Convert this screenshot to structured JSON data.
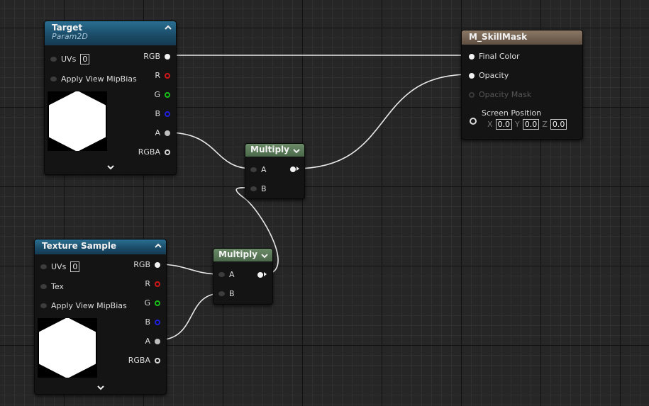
{
  "nodes": {
    "target": {
      "title": "Target",
      "subtitle": "Param2D",
      "uvs_label": "UVs",
      "uvs_value": "0",
      "mip_label": "Apply View MipBias",
      "outputs": [
        "RGB",
        "R",
        "G",
        "B",
        "A",
        "RGBA"
      ]
    },
    "multiply_top": {
      "title": "Multiply",
      "inputs": [
        "A",
        "B"
      ]
    },
    "multiply_bottom": {
      "title": "Multiply",
      "inputs": [
        "A",
        "B"
      ]
    },
    "texture_sample": {
      "title": "Texture Sample",
      "uvs_label": "UVs",
      "uvs_value": "0",
      "tex_label": "Tex",
      "mip_label": "Apply View MipBias",
      "outputs": [
        "RGB",
        "R",
        "G",
        "B",
        "A",
        "RGBA"
      ]
    },
    "material": {
      "title": "M_SkillMask",
      "inputs": [
        "Final Color",
        "Opacity",
        "Opacity Mask"
      ],
      "screen_position_label": "Screen Position",
      "screen_position": {
        "x_label": "X",
        "x": "0.0",
        "y_label": "Y",
        "y": "0.0",
        "z_label": "Z",
        "z": "0.0"
      }
    }
  },
  "colors": {
    "background": "#262626",
    "param_header": "#1a4a66",
    "math_header": "#4b6a4b",
    "material_header": "#6f5e4f",
    "pin_red": "#d01818",
    "pin_green": "#18c018",
    "pin_blue": "#2020e0",
    "wire": "#e8e8e8"
  },
  "icons": {
    "collapse": "chevron-up-icon",
    "expand": "chevron-down-icon",
    "dropdown": "chevron-down-icon"
  }
}
